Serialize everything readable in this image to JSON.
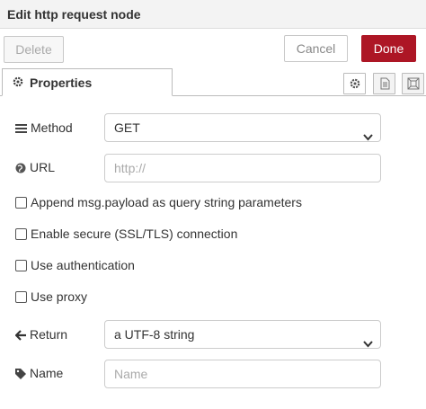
{
  "header": {
    "title": "Edit http request node"
  },
  "buttons": {
    "delete": "Delete",
    "cancel": "Cancel",
    "done": "Done"
  },
  "tabs": {
    "properties": "Properties"
  },
  "form": {
    "method": {
      "label": "Method",
      "value": "GET"
    },
    "url": {
      "label": "URL",
      "value": "",
      "placeholder": "http://"
    },
    "append_payload": {
      "label": "Append msg.payload as query string parameters",
      "checked": false
    },
    "secure": {
      "label": "Enable secure (SSL/TLS) connection",
      "checked": false
    },
    "auth": {
      "label": "Use authentication",
      "checked": false
    },
    "proxy": {
      "label": "Use proxy",
      "checked": false
    },
    "return": {
      "label": "Return",
      "value": "a UTF-8 string"
    },
    "name": {
      "label": "Name",
      "value": "",
      "placeholder": "Name"
    }
  },
  "colors": {
    "done_button": "#ad1625",
    "header_bg": "#f3f3f3"
  },
  "icons": {
    "tab_properties": "gear-icon",
    "method": "list-icon",
    "url": "globe-icon",
    "return": "arrow-left-icon",
    "name": "tag-icon",
    "settings_tab": "gear-icon",
    "description_tab": "file-text-icon",
    "appearance_tab": "frame-icon"
  }
}
